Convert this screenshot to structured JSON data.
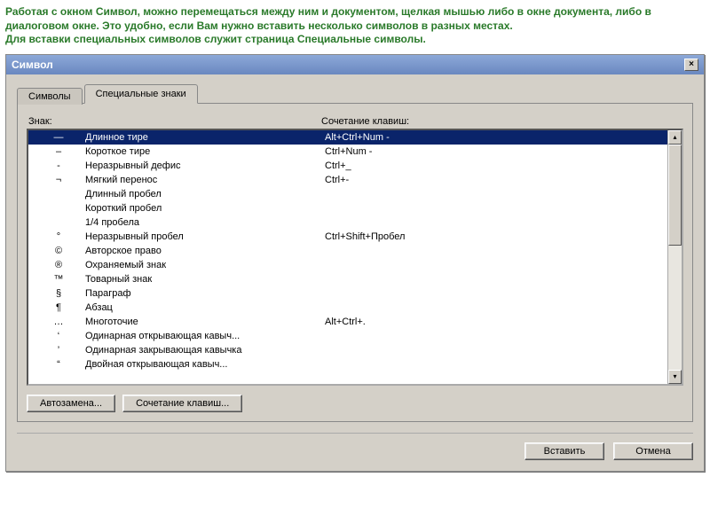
{
  "intro": {
    "p1": "Работая с окном Символ, можно перемещаться между ним и документом, щелкая мышью либо в окне документа, либо в диалоговом окне. Это удобно, если Вам нужно вставить несколько символов в разных местах.",
    "p2": "Для вставки специальных символов служит страница Специальные символы."
  },
  "dialog": {
    "title": "Символ",
    "tabs": {
      "symbols": "Символы",
      "special": "Специальные знаки"
    },
    "headers": {
      "sign": "Знак:",
      "shortcut": "Сочетание клавиш:"
    },
    "rows": [
      {
        "sym": "—",
        "name": "Длинное тире",
        "key": "Alt+Ctrl+Num -",
        "selected": true
      },
      {
        "sym": "–",
        "name": "Короткое тире",
        "key": "Ctrl+Num -"
      },
      {
        "sym": "-",
        "name": "Неразрывный дефис",
        "key": "Ctrl+_"
      },
      {
        "sym": "¬",
        "name": "Мягкий перенос",
        "key": "Ctrl+-"
      },
      {
        "sym": "",
        "name": "Длинный пробел",
        "key": ""
      },
      {
        "sym": "",
        "name": "Короткий пробел",
        "key": ""
      },
      {
        "sym": "",
        "name": "1/4 пробела",
        "key": ""
      },
      {
        "sym": "°",
        "name": "Неразрывный пробел",
        "key": "Ctrl+Shift+Пробел"
      },
      {
        "sym": "©",
        "name": "Авторское право",
        "key": ""
      },
      {
        "sym": "®",
        "name": "Охраняемый знак",
        "key": ""
      },
      {
        "sym": "™",
        "name": "Товарный знак",
        "key": ""
      },
      {
        "sym": "§",
        "name": "Параграф",
        "key": ""
      },
      {
        "sym": "¶",
        "name": "Абзац",
        "key": ""
      },
      {
        "sym": "…",
        "name": "Многоточие",
        "key": "Alt+Ctrl+."
      },
      {
        "sym": "‘",
        "name": "Одинарная открывающая кавыч...",
        "key": ""
      },
      {
        "sym": "’",
        "name": "Одинарная закрывающая кавычка",
        "key": ""
      },
      {
        "sym": "“",
        "name": "Двойная открывающая кавыч...",
        "key": ""
      }
    ],
    "buttons": {
      "autocorrect": "Автозамена...",
      "shortcut": "Сочетание клавиш...",
      "insert": "Вставить",
      "cancel": "Отмена"
    }
  }
}
